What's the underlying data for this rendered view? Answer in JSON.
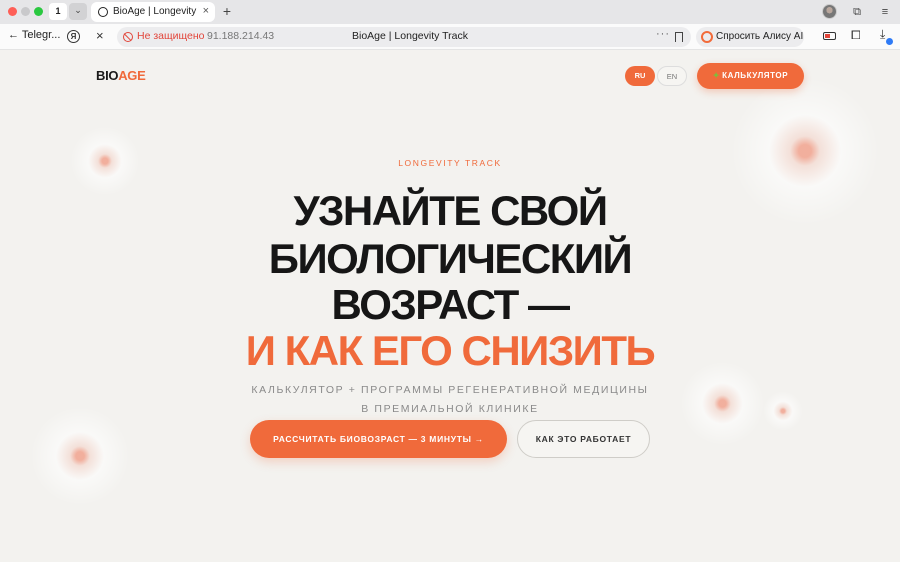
{
  "browser": {
    "tab_count": "1",
    "tab_title": "BioAge | Longevity Track",
    "back_label": "Telegr...",
    "security_warning": "Не защищено",
    "url": "91.188.214.43",
    "page_title": "BioAge | Longevity Track",
    "alice_label": "Спросить Алису AI"
  },
  "header": {
    "logo_part1": "BIO",
    "logo_part2": "AGE",
    "lang_ru": "RU",
    "lang_en": "EN",
    "calculator_label": "КАЛЬКУЛЯТОР"
  },
  "hero": {
    "eyebrow": "LONGEVITY TRACK",
    "title_line1": "УЗНАЙТЕ СВОЙ",
    "title_line2": "БИОЛОГИЧЕСКИЙ",
    "title_line3": "ВОЗРАСТ —",
    "title_line4": "И КАК ЕГО СНИЗИТЬ",
    "subtitle": "КАЛЬКУЛЯТОР + ПРОГРАММЫ РЕГЕНЕРАТИВНОЙ МЕДИЦИНЫ В ПРЕМИАЛЬНОЙ КЛИНИКЕ",
    "cta_label": "РАССЧИТАТЬ БИОВОЗРАСТ — 3 МИНУТЫ →",
    "how_label": "КАК ЭТО РАБОТАЕТ"
  },
  "colors": {
    "accent": "#f06a3b",
    "background": "#f3f2ef",
    "text": "#161616"
  }
}
